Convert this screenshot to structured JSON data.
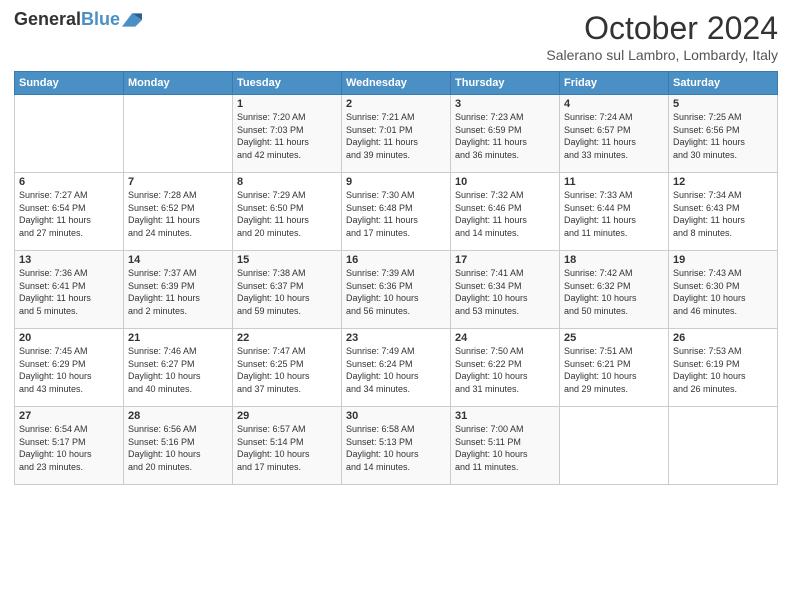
{
  "header": {
    "logo_line1": "General",
    "logo_line2": "Blue",
    "month": "October 2024",
    "location": "Salerano sul Lambro, Lombardy, Italy"
  },
  "days_of_week": [
    "Sunday",
    "Monday",
    "Tuesday",
    "Wednesday",
    "Thursday",
    "Friday",
    "Saturday"
  ],
  "weeks": [
    [
      {
        "day": "",
        "info": ""
      },
      {
        "day": "",
        "info": ""
      },
      {
        "day": "1",
        "info": "Sunrise: 7:20 AM\nSunset: 7:03 PM\nDaylight: 11 hours\nand 42 minutes."
      },
      {
        "day": "2",
        "info": "Sunrise: 7:21 AM\nSunset: 7:01 PM\nDaylight: 11 hours\nand 39 minutes."
      },
      {
        "day": "3",
        "info": "Sunrise: 7:23 AM\nSunset: 6:59 PM\nDaylight: 11 hours\nand 36 minutes."
      },
      {
        "day": "4",
        "info": "Sunrise: 7:24 AM\nSunset: 6:57 PM\nDaylight: 11 hours\nand 33 minutes."
      },
      {
        "day": "5",
        "info": "Sunrise: 7:25 AM\nSunset: 6:56 PM\nDaylight: 11 hours\nand 30 minutes."
      }
    ],
    [
      {
        "day": "6",
        "info": "Sunrise: 7:27 AM\nSunset: 6:54 PM\nDaylight: 11 hours\nand 27 minutes."
      },
      {
        "day": "7",
        "info": "Sunrise: 7:28 AM\nSunset: 6:52 PM\nDaylight: 11 hours\nand 24 minutes."
      },
      {
        "day": "8",
        "info": "Sunrise: 7:29 AM\nSunset: 6:50 PM\nDaylight: 11 hours\nand 20 minutes."
      },
      {
        "day": "9",
        "info": "Sunrise: 7:30 AM\nSunset: 6:48 PM\nDaylight: 11 hours\nand 17 minutes."
      },
      {
        "day": "10",
        "info": "Sunrise: 7:32 AM\nSunset: 6:46 PM\nDaylight: 11 hours\nand 14 minutes."
      },
      {
        "day": "11",
        "info": "Sunrise: 7:33 AM\nSunset: 6:44 PM\nDaylight: 11 hours\nand 11 minutes."
      },
      {
        "day": "12",
        "info": "Sunrise: 7:34 AM\nSunset: 6:43 PM\nDaylight: 11 hours\nand 8 minutes."
      }
    ],
    [
      {
        "day": "13",
        "info": "Sunrise: 7:36 AM\nSunset: 6:41 PM\nDaylight: 11 hours\nand 5 minutes."
      },
      {
        "day": "14",
        "info": "Sunrise: 7:37 AM\nSunset: 6:39 PM\nDaylight: 11 hours\nand 2 minutes."
      },
      {
        "day": "15",
        "info": "Sunrise: 7:38 AM\nSunset: 6:37 PM\nDaylight: 10 hours\nand 59 minutes."
      },
      {
        "day": "16",
        "info": "Sunrise: 7:39 AM\nSunset: 6:36 PM\nDaylight: 10 hours\nand 56 minutes."
      },
      {
        "day": "17",
        "info": "Sunrise: 7:41 AM\nSunset: 6:34 PM\nDaylight: 10 hours\nand 53 minutes."
      },
      {
        "day": "18",
        "info": "Sunrise: 7:42 AM\nSunset: 6:32 PM\nDaylight: 10 hours\nand 50 minutes."
      },
      {
        "day": "19",
        "info": "Sunrise: 7:43 AM\nSunset: 6:30 PM\nDaylight: 10 hours\nand 46 minutes."
      }
    ],
    [
      {
        "day": "20",
        "info": "Sunrise: 7:45 AM\nSunset: 6:29 PM\nDaylight: 10 hours\nand 43 minutes."
      },
      {
        "day": "21",
        "info": "Sunrise: 7:46 AM\nSunset: 6:27 PM\nDaylight: 10 hours\nand 40 minutes."
      },
      {
        "day": "22",
        "info": "Sunrise: 7:47 AM\nSunset: 6:25 PM\nDaylight: 10 hours\nand 37 minutes."
      },
      {
        "day": "23",
        "info": "Sunrise: 7:49 AM\nSunset: 6:24 PM\nDaylight: 10 hours\nand 34 minutes."
      },
      {
        "day": "24",
        "info": "Sunrise: 7:50 AM\nSunset: 6:22 PM\nDaylight: 10 hours\nand 31 minutes."
      },
      {
        "day": "25",
        "info": "Sunrise: 7:51 AM\nSunset: 6:21 PM\nDaylight: 10 hours\nand 29 minutes."
      },
      {
        "day": "26",
        "info": "Sunrise: 7:53 AM\nSunset: 6:19 PM\nDaylight: 10 hours\nand 26 minutes."
      }
    ],
    [
      {
        "day": "27",
        "info": "Sunrise: 6:54 AM\nSunset: 5:17 PM\nDaylight: 10 hours\nand 23 minutes."
      },
      {
        "day": "28",
        "info": "Sunrise: 6:56 AM\nSunset: 5:16 PM\nDaylight: 10 hours\nand 20 minutes."
      },
      {
        "day": "29",
        "info": "Sunrise: 6:57 AM\nSunset: 5:14 PM\nDaylight: 10 hours\nand 17 minutes."
      },
      {
        "day": "30",
        "info": "Sunrise: 6:58 AM\nSunset: 5:13 PM\nDaylight: 10 hours\nand 14 minutes."
      },
      {
        "day": "31",
        "info": "Sunrise: 7:00 AM\nSunset: 5:11 PM\nDaylight: 10 hours\nand 11 minutes."
      },
      {
        "day": "",
        "info": ""
      },
      {
        "day": "",
        "info": ""
      }
    ]
  ]
}
